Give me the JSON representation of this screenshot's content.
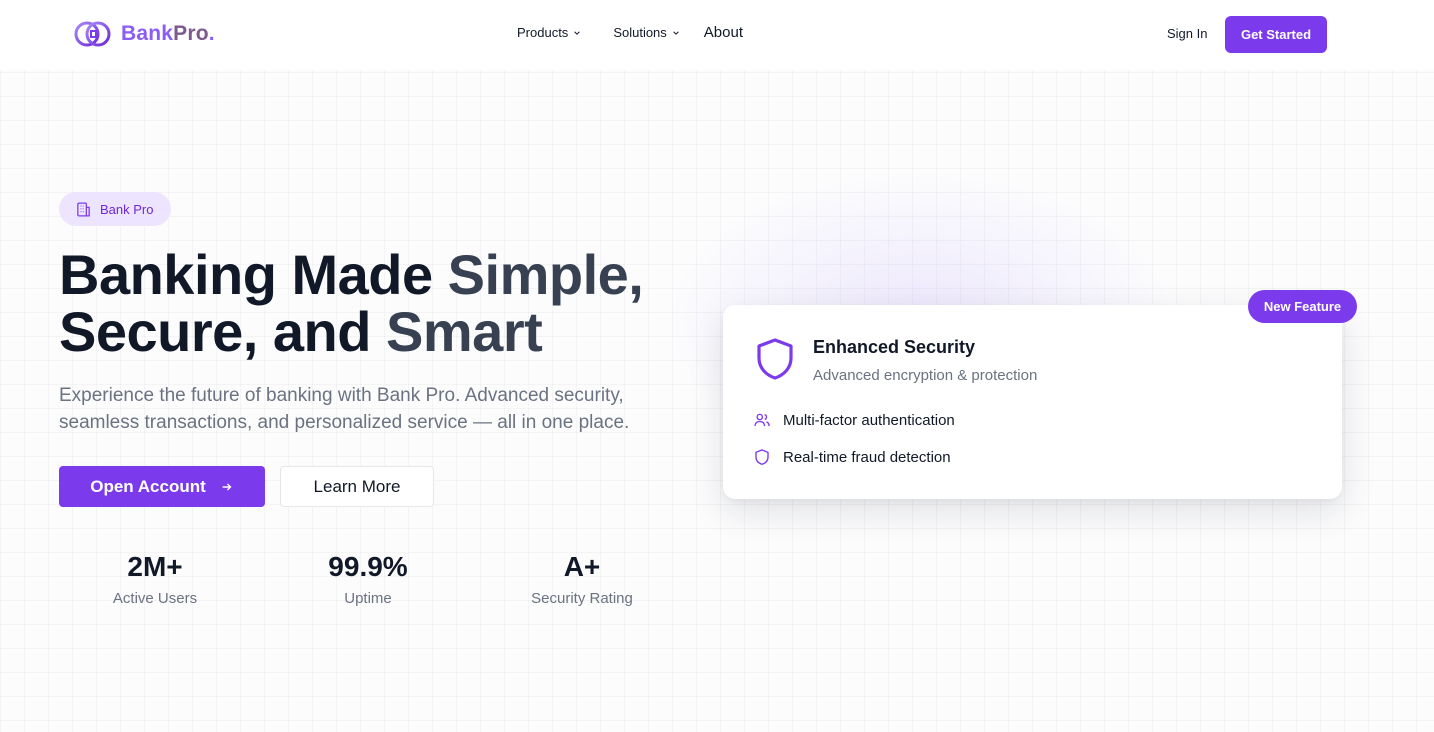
{
  "header": {
    "logo": {
      "part1": "Bank",
      "part2": "Pro",
      "dot": ".",
      "icon": "bank-logo-icon"
    },
    "nav": [
      {
        "label": "Products",
        "has_dropdown": true
      },
      {
        "label": "Solutions",
        "has_dropdown": true
      },
      {
        "label": "About",
        "has_dropdown": false
      }
    ],
    "sign_in": "Sign In",
    "cta": "Get Started"
  },
  "hero": {
    "badge": {
      "label": "Bank Pro",
      "icon": "building-icon"
    },
    "headline_line1_a": "Banking Made ",
    "headline_line1_b": "Simple,",
    "headline_line2_a": "Secure, and ",
    "headline_line2_b": "Smart",
    "subtext": "Experience the future of banking with Bank Pro. Advanced security, seamless transactions, and personalized service — all in one place.",
    "primary_button": "Open Account",
    "secondary_button": "Learn More",
    "stats": [
      {
        "value": "2M+",
        "label": "Active Users"
      },
      {
        "value": "99.9%",
        "label": "Uptime"
      },
      {
        "value": "A+",
        "label": "Security Rating"
      }
    ]
  },
  "feature_card": {
    "badge": "New Feature",
    "title": "Enhanced Security",
    "subtitle": "Advanced encryption & protection",
    "items": [
      {
        "label": "Multi-factor authentication",
        "icon": "users-icon"
      },
      {
        "label": "Real-time fraud detection",
        "icon": "shield-icon"
      }
    ]
  },
  "colors": {
    "accent": "#7c3aed",
    "accent_light": "#ede4ff",
    "text_dark": "#111827",
    "text_muted": "#6b7280"
  }
}
